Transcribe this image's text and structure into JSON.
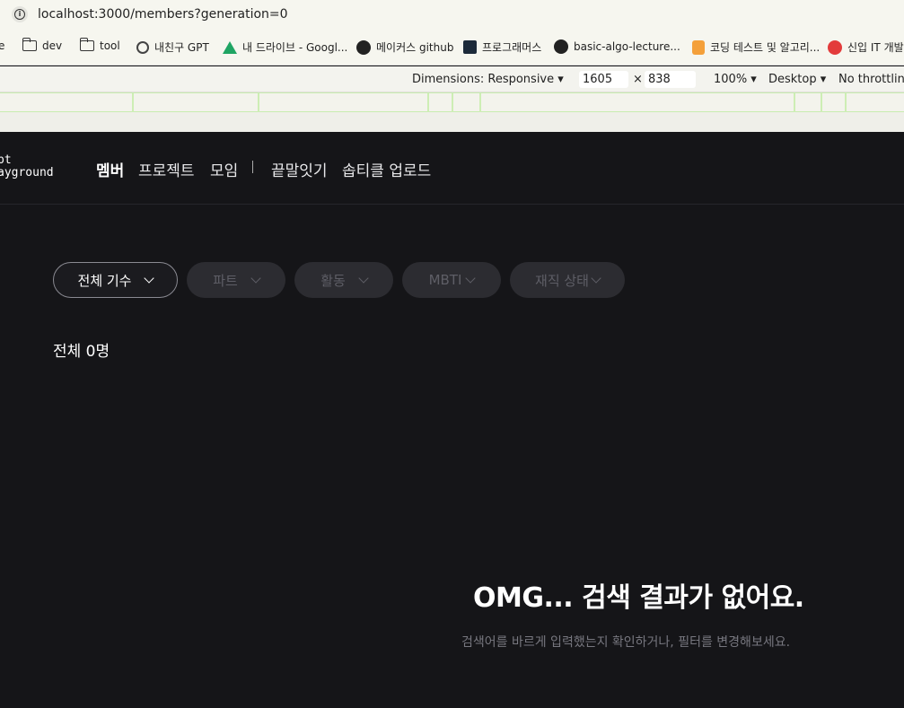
{
  "browser": {
    "url": "localhost:3000/members?generation=0",
    "bookmarks": [
      {
        "label": "e",
        "icon": "partial-icon"
      },
      {
        "label": "dev",
        "icon": "folder-icon"
      },
      {
        "label": "tool",
        "icon": "folder-icon"
      },
      {
        "label": "내친구 GPT",
        "icon": "openai-icon"
      },
      {
        "label": "내 드라이브 - Googl...",
        "icon": "google-drive-icon"
      },
      {
        "label": "메이커스 github",
        "icon": "github-icon"
      },
      {
        "label": "프로그래머스",
        "icon": "programmers-icon"
      },
      {
        "label": "basic-algo-lecture...",
        "icon": "github-icon"
      },
      {
        "label": "코딩 테스트 및 알고리...",
        "icon": "coding-icon"
      },
      {
        "label": "신입 IT 개발자",
        "icon": "red-circle-icon"
      }
    ],
    "devtools": {
      "dimensions_label": "Dimensions: Responsive",
      "width": "1605",
      "times": "×",
      "height": "838",
      "zoom": "100%",
      "device": "Desktop",
      "throttling": "No throttling"
    }
  },
  "app": {
    "logo_line1": "pt",
    "logo_line2": "ayground",
    "nav": {
      "members": "멤버",
      "projects": "프로젝트",
      "groups": "모임",
      "separator": "|",
      "word_chain": "끝말잇기",
      "soptickle": "솝티클 업로드"
    },
    "filters": {
      "generation": "전체 기수",
      "part": "파트",
      "activity": "활동",
      "mbti": "MBTI",
      "employment": "재직 상태"
    },
    "count_label": "전체 0명",
    "empty": {
      "title": "OMG... 검색 결과가 없어요.",
      "subtitle": "검색어를 바르게 입력했는지 확인하거나, 필터를 변경해보세요."
    }
  },
  "colors": {
    "background": "#151518",
    "chip_disabled": "#2c2c31",
    "text_muted": "#77777f"
  }
}
